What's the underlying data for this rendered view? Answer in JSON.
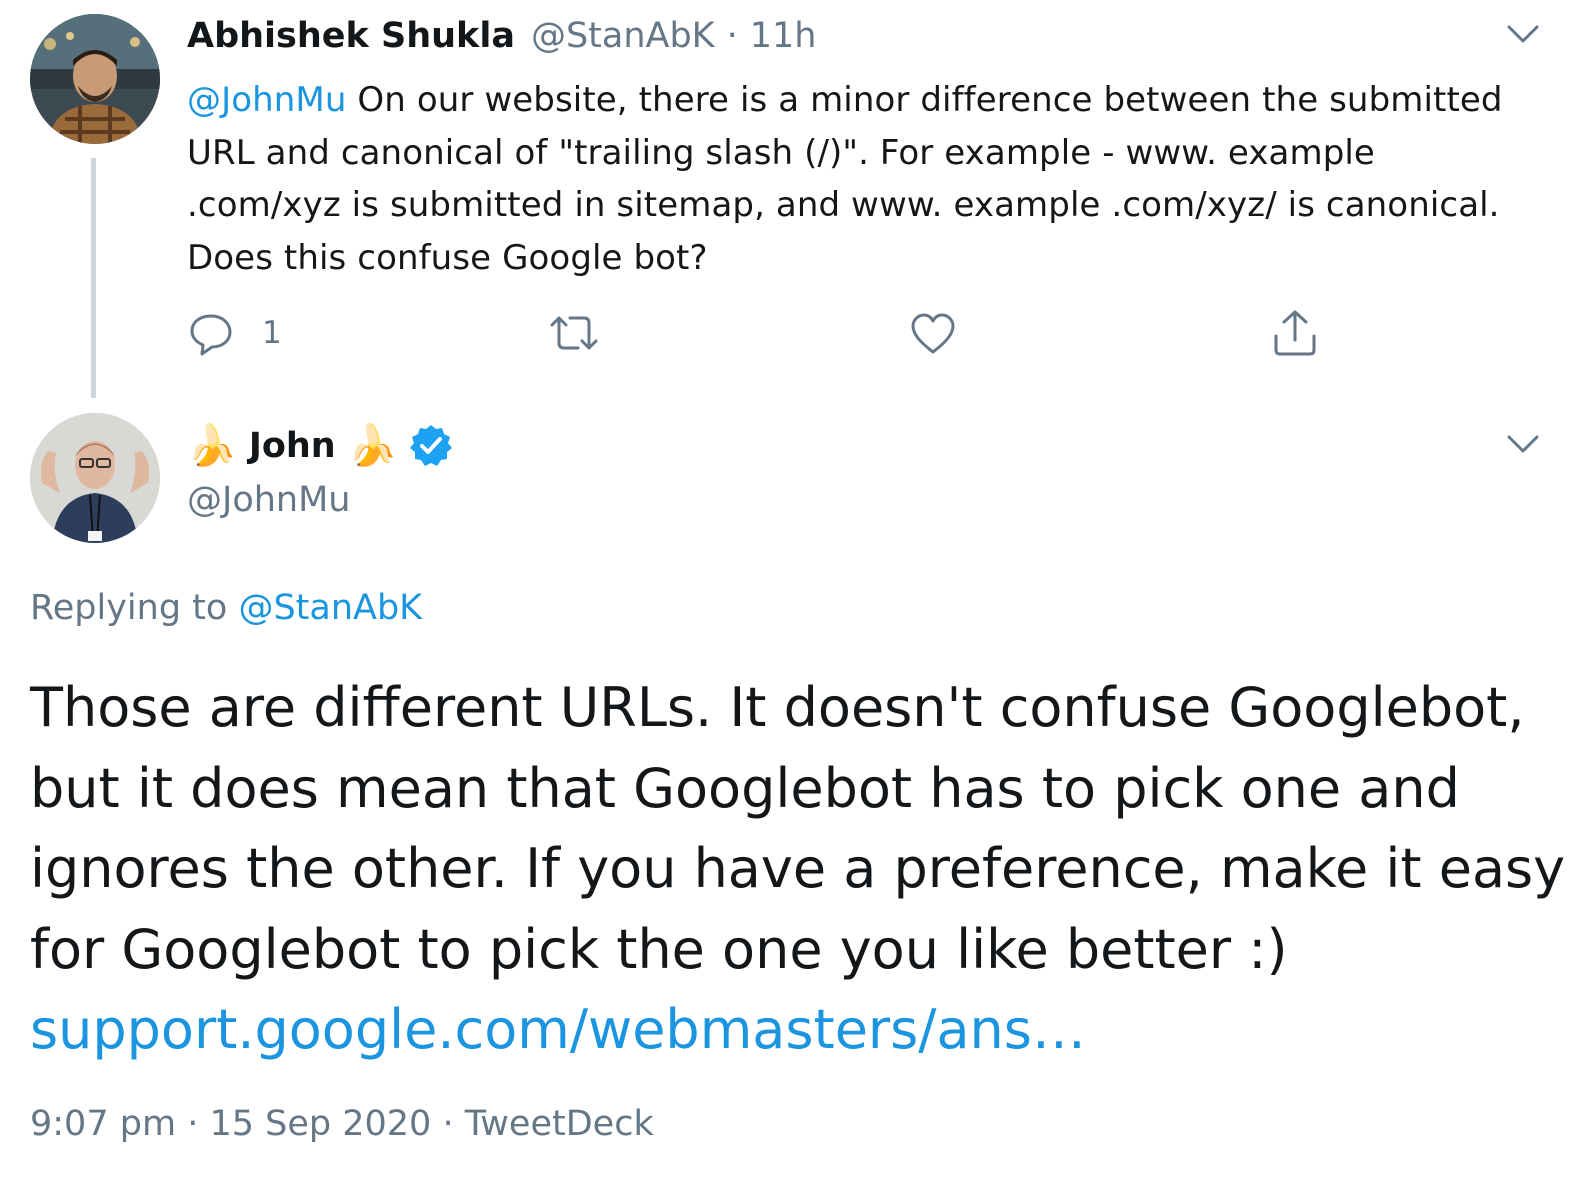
{
  "colors": {
    "text": "#14171a",
    "muted": "#657786",
    "link": "#1b95e0",
    "verified": "#1da1f2",
    "thread_line": "#ccd6dd"
  },
  "parent_tweet": {
    "author_name": "Abhishek Shukla",
    "author_handle": "@StanAbK",
    "separator": "·",
    "time_ago": "11h",
    "mention": "@JohnMu",
    "body": " On our website, there is a minor difference between the submitted URL and canonical of \"trailing slash (/)\". For example - www. example .com/xyz is submitted in sitemap, and www. example .com/xyz/ is canonical. Does this confuse Google bot?",
    "actions": {
      "reply_icon": "reply-icon",
      "reply_count": "1",
      "retweet_icon": "retweet-icon",
      "like_icon": "heart-icon",
      "share_icon": "share-icon"
    },
    "menu_icon": "chevron-down-icon"
  },
  "reply_tweet": {
    "name_emoji_left": "🍌",
    "author_name": "John",
    "name_emoji_right": "🍌",
    "verified_icon": "verified-badge-icon",
    "author_handle": "@JohnMu",
    "replying_label": "Replying to ",
    "replying_handle": "@StanAbK",
    "body": "Those are different URLs. It doesn't confuse Googlebot, but it does mean that Googlebot has to pick one and ignores the other. If you have a preference, make it easy for Googlebot to pick the one you like better :)",
    "link_text": "support.google.com/webmasters/ans…",
    "time": "9:07 pm",
    "separator": "·",
    "date": "15 Sep 2020",
    "client": "TweetDeck",
    "menu_icon": "chevron-down-icon"
  }
}
